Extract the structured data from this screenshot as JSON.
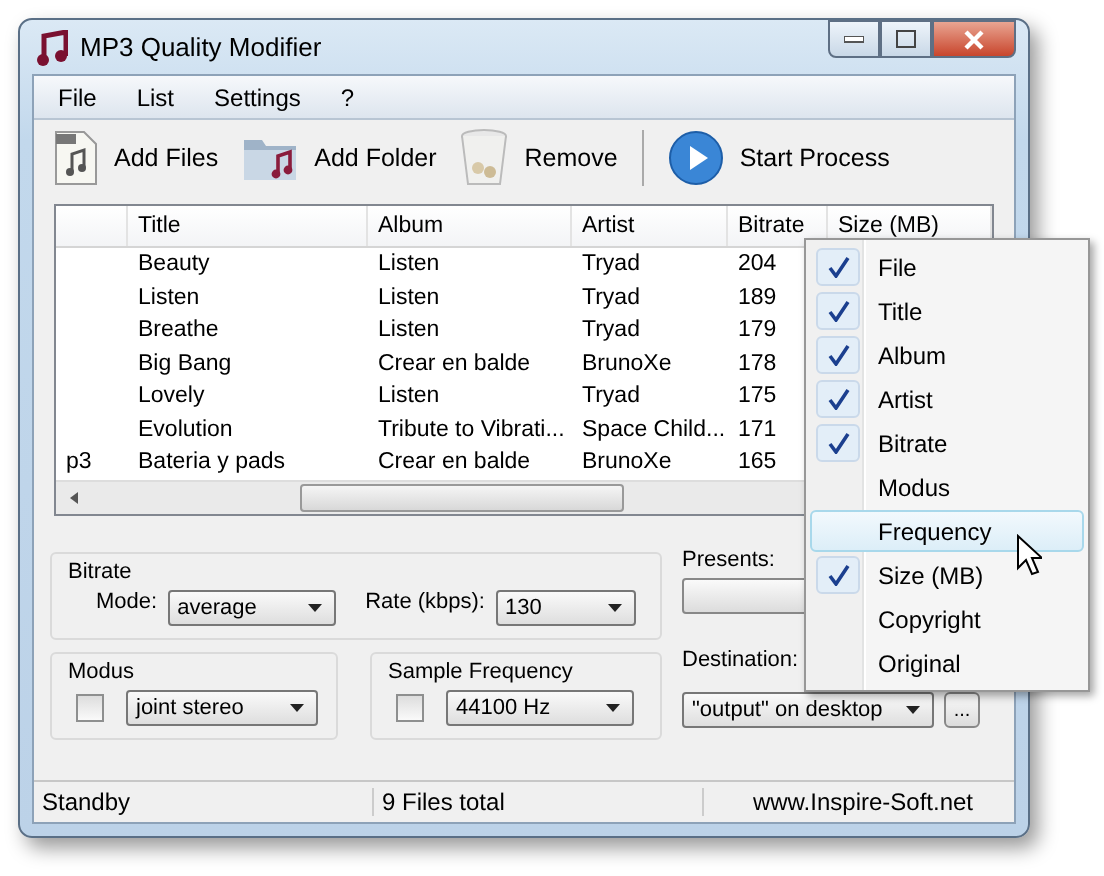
{
  "window": {
    "title": "MP3 Quality Modifier"
  },
  "menu": [
    "File",
    "List",
    "Settings",
    "?"
  ],
  "toolbar": [
    {
      "kind": "file",
      "label": "Add Files"
    },
    {
      "kind": "folder",
      "label": "Add Folder"
    },
    {
      "kind": "bin",
      "label": "Remove"
    },
    {
      "kind": "play",
      "label": "Start Process"
    }
  ],
  "table": {
    "columns": [
      "Title",
      "Album",
      "Artist",
      "Bitrate",
      "Size (MB)"
    ],
    "rows": [
      {
        "title": "Beauty",
        "album": "Listen",
        "artist": "Tryad",
        "bitrate": "204"
      },
      {
        "title": "Listen",
        "album": "Listen",
        "artist": "Tryad",
        "bitrate": "189"
      },
      {
        "title": "Breathe",
        "album": "Listen",
        "artist": "Tryad",
        "bitrate": "179"
      },
      {
        "title": "Big Bang",
        "album": "Crear en balde",
        "artist": "BrunoXe",
        "bitrate": "178"
      },
      {
        "title": "Lovely",
        "album": "Listen",
        "artist": "Tryad",
        "bitrate": "175"
      },
      {
        "title": "Evolution",
        "album": "Tribute to Vibrati...",
        "artist": "Space Child...",
        "bitrate": "171"
      },
      {
        "file": "p3",
        "title": "Bateria y pads",
        "album": "Crear en balde",
        "artist": "BrunoXe",
        "bitrate": "165"
      }
    ]
  },
  "context_menu": {
    "items": [
      {
        "label": "File",
        "checked": true,
        "selected": false
      },
      {
        "label": "Title",
        "checked": true,
        "selected": false
      },
      {
        "label": "Album",
        "checked": true,
        "selected": false
      },
      {
        "label": "Artist",
        "checked": true,
        "selected": false
      },
      {
        "label": "Bitrate",
        "checked": true,
        "selected": false
      },
      {
        "label": "Modus",
        "checked": false,
        "selected": false
      },
      {
        "label": "Frequency",
        "checked": false,
        "selected": true
      },
      {
        "label": "Size (MB)",
        "checked": true,
        "selected": false
      },
      {
        "label": "Copyright",
        "checked": false,
        "selected": false
      },
      {
        "label": "Original",
        "checked": false,
        "selected": false
      }
    ]
  },
  "bitrate": {
    "title": "Bitrate",
    "mode_label": "Mode:",
    "mode": "average",
    "rate_label": "Rate (kbps):",
    "rate": "130"
  },
  "modus": {
    "title": "Modus",
    "checked": false,
    "value": "joint stereo"
  },
  "sample_frequency": {
    "title": "Sample Frequency",
    "checked": false,
    "value": "44100 Hz"
  },
  "presents": {
    "label": "Presents:"
  },
  "destination": {
    "label": "Destination:",
    "value": "\"output\" on desktop",
    "browse": "..."
  },
  "status_bar": [
    "Standby",
    "9 Files total",
    "www.Inspire-Soft.net"
  ]
}
